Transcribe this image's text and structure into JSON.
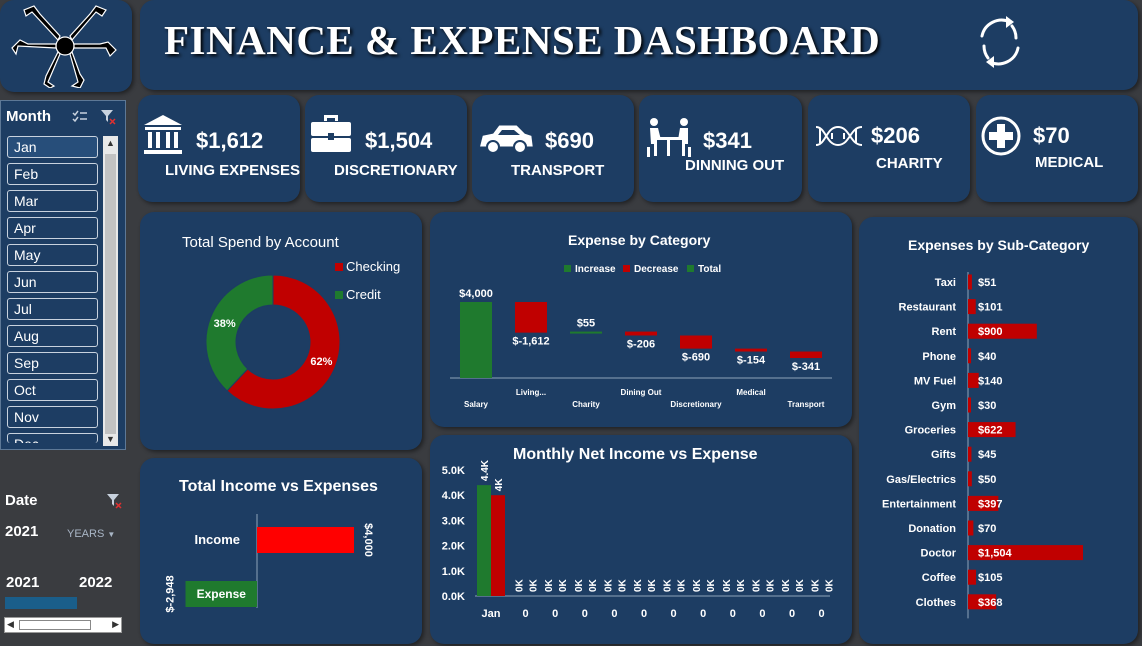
{
  "header": {
    "title": "FINANCE & EXPENSE DASHBOARD"
  },
  "kpis": [
    {
      "value": "$1,612",
      "label": "LIVING EXPENSES",
      "icon": "bank-icon"
    },
    {
      "value": "$1,504",
      "label": "DISCRETIONARY",
      "icon": "briefcase-icon"
    },
    {
      "value": "$690",
      "label": "TRANSPORT",
      "icon": "car-icon"
    },
    {
      "value": "$341",
      "label": "DINNING OUT",
      "icon": "dining-icon"
    },
    {
      "value": "$206",
      "label": "CHARITY",
      "icon": "dna-icon"
    },
    {
      "value": "$70",
      "label": "MEDICAL",
      "icon": "medical-cross-icon"
    }
  ],
  "month_slicer": {
    "header": "Month",
    "months": [
      "Jan",
      "Feb",
      "Mar",
      "Apr",
      "May",
      "Jun",
      "Jul",
      "Aug",
      "Sep",
      "Oct",
      "Nov",
      "Dec"
    ],
    "selected": "Jan"
  },
  "date_slicer": {
    "header": "Date",
    "year": "2021",
    "level": "YEARS",
    "timeline": [
      "2021",
      "2022"
    ]
  },
  "colors": {
    "green": "#1f7a2e",
    "red": "#c00000",
    "bright_red": "#ff0000",
    "panel": "#1d3d63",
    "background": "#3a3c40"
  },
  "chart_data": [
    {
      "type": "pie",
      "title": "Total Spend by Account",
      "categories": [
        "Checking",
        "Credit"
      ],
      "values": [
        62,
        38
      ],
      "labels": [
        "62%",
        "38%"
      ],
      "colors": [
        "#c00000",
        "#1f7a2e"
      ],
      "legend": "right"
    },
    {
      "type": "bar",
      "subtype": "waterfall",
      "title": "Expense by Category",
      "legend": [
        "Increase",
        "Decrease",
        "Total"
      ],
      "categories": [
        "Salary",
        "Living...",
        "Charity",
        "Dining Out",
        "Discretionary",
        "Medical",
        "Transport"
      ],
      "values": [
        4000,
        -1612,
        55,
        -206,
        -690,
        -154,
        -341
      ],
      "labels": [
        "$4,000",
        "$-1,612",
        "$55",
        "$-206",
        "$-690",
        "$-154",
        "$-341"
      ]
    },
    {
      "type": "bar",
      "orientation": "horizontal",
      "title": "Expenses by Sub-Category",
      "categories": [
        "Taxi",
        "Restaurant",
        "Rent",
        "Phone",
        "MV Fuel",
        "Gym",
        "Groceries",
        "Gifts",
        "Gas/Electrics",
        "Entertainment",
        "Donation",
        "Doctor",
        "Coffee",
        "Clothes"
      ],
      "values": [
        51,
        101,
        900,
        40,
        140,
        30,
        622,
        45,
        50,
        397,
        70,
        1504,
        105,
        368
      ],
      "labels": [
        "$51",
        "$101",
        "$900",
        "$40",
        "$140",
        "$30",
        "$622",
        "$45",
        "$50",
        "$397",
        "$70",
        "$1,504",
        "$105",
        "$368"
      ]
    },
    {
      "type": "bar",
      "orientation": "horizontal",
      "title": "Total Income vs Expenses",
      "categories": [
        "Income",
        "Expense"
      ],
      "values": [
        4000,
        -2948
      ],
      "labels": [
        "$4,000",
        "$-2,948"
      ]
    },
    {
      "type": "bar",
      "title": "Monthly Net Income vs Expense",
      "categories": [
        "Jan",
        "0",
        "0",
        "0",
        "0",
        "0",
        "0",
        "0",
        "0",
        "0",
        "0",
        "0"
      ],
      "series": [
        {
          "values": [
            4400,
            0,
            0,
            0,
            0,
            0,
            0,
            0,
            0,
            0,
            0,
            0
          ],
          "color": "#1f7a2e",
          "labels": [
            "4.4K",
            "0K",
            "0K",
            "0K",
            "0K",
            "0K",
            "0K",
            "0K",
            "0K",
            "0K",
            "0K",
            "0K"
          ]
        },
        {
          "values": [
            4000,
            0,
            0,
            0,
            0,
            0,
            0,
            0,
            0,
            0,
            0,
            0
          ],
          "color": "#c00000",
          "labels": [
            "4K",
            "0K",
            "0K",
            "0K",
            "0K",
            "0K",
            "0K",
            "0K",
            "0K",
            "0K",
            "0K",
            "0K"
          ]
        }
      ],
      "yticks": [
        "0.0K",
        "1.0K",
        "2.0K",
        "3.0K",
        "4.0K",
        "5.0K"
      ],
      "ylim": [
        0,
        5000
      ]
    }
  ]
}
